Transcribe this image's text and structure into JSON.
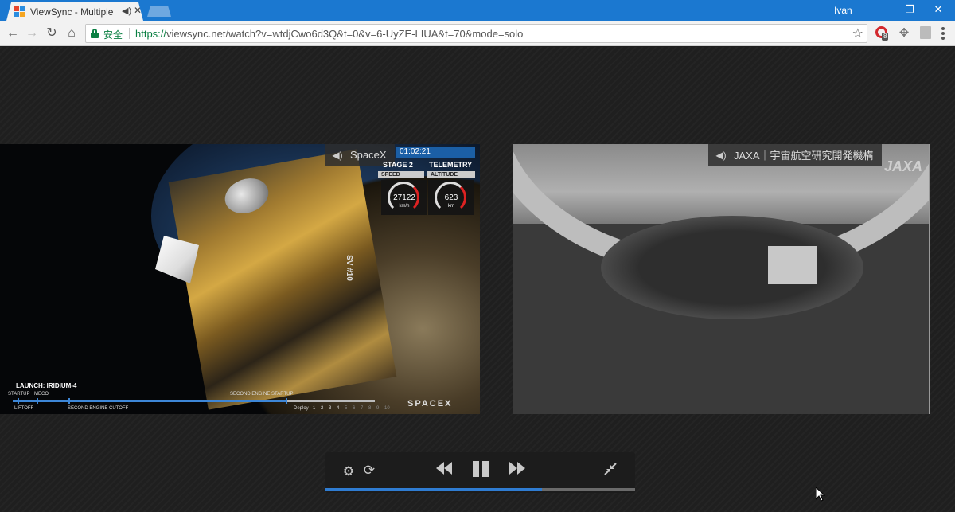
{
  "browser": {
    "tab_title": "ViewSync - Multiple",
    "tab_audio_icon": "speaker-icon",
    "user_name": "Ivan",
    "secure_label": "安全",
    "url_scheme": "https://",
    "url_rest": "viewsync.net/watch?v=wtdjCwo6d3Q&t=0&v=6-UyZE-LIUA&t=70&mode=solo",
    "ext_badge": "8",
    "colors": {
      "titlebar": "#1b78d0",
      "secure": "#0b8043"
    }
  },
  "videos": [
    {
      "label": "SpaceX",
      "telemetry": {
        "time": "01:02:21",
        "stage": "STAGE 2",
        "telemetry_label": "TELEMETRY",
        "speed_label": "SPEED",
        "altitude_label": "ALTITUDE",
        "speed_value": "27122",
        "speed_unit": "km/h",
        "altitude_value": "623",
        "altitude_unit": "km"
      },
      "overlay": {
        "sv_label": "SV #10",
        "launch_title": "LAUNCH: IRIDIUM-4",
        "timeline_top": [
          "STARTUP",
          "MECO",
          "SECOND ENGINE STARTUP"
        ],
        "timeline_bottom": [
          "LIFTOFF",
          "SECOND ENGINE CUTOFF",
          "Deploy",
          "1",
          "2",
          "3",
          "4",
          "5",
          "6",
          "7",
          "8",
          "9",
          "10"
        ],
        "brand": "SPACEX"
      }
    },
    {
      "label": "JAXA｜宇宙航空研究開発機構",
      "overlay": {
        "brand": "JAXA"
      }
    }
  ],
  "controls": {
    "progress": 0.7,
    "icons": [
      "gear-icon",
      "sync-icon",
      "rewind-icon",
      "pause-icon",
      "fast-forward-icon",
      "collapse-icon"
    ]
  }
}
